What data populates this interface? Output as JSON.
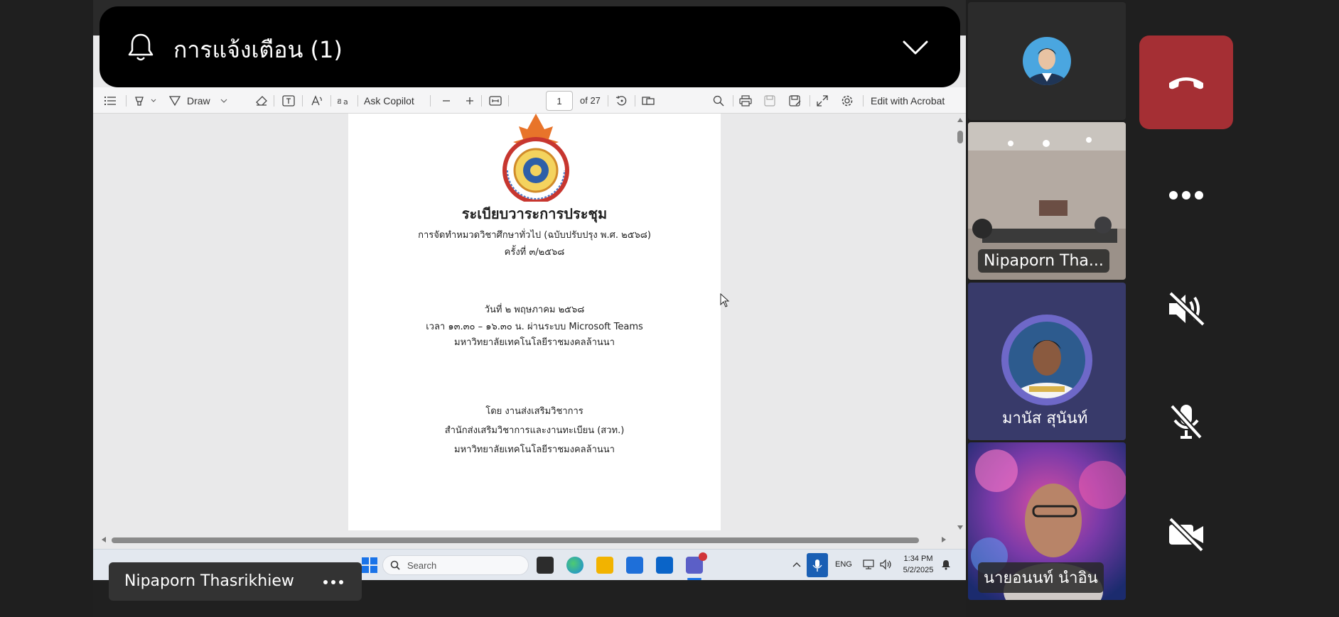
{
  "notification": {
    "text": "การแจ้งเตือน (1)",
    "bell_icon": "bell-icon",
    "chevron_icon": "chevron-down-icon"
  },
  "toolbar": {
    "draw_label": "Draw",
    "ask_copilot_label": "Ask Copilot",
    "page_current": "1",
    "page_total": "of 27",
    "edit_label": "Edit with Acrobat"
  },
  "document": {
    "title": "ระเบียบวาระการประชุม",
    "subtitle": "การจัดทำหมวดวิชาศึกษาทั่วไป (ฉบับปรับปรุง พ.ศ. ๒๕๖๘)",
    "session": "ครั้งที่ ๓/๒๕๖๘",
    "date": "วันที่ ๒ พฤษภาคม ๒๕๖๘",
    "time": "เวลา ๑๓.๓๐ – ๑๖.๓๐ น. ผ่านระบบ Microsoft Teams",
    "university_1": "มหาวิทยาลัยเทคโนโลยีราชมงคลล้านนา",
    "by": "โดย งานส่งเสริมวิชาการ",
    "office": "สำนักส่งเสริมวิชาการและงานทะเบียน (สวท.)",
    "university_2": "มหาวิทยาลัยเทคโนโลยีราชมงคลล้านนา"
  },
  "taskbar": {
    "search_placeholder": "Search",
    "lang": "ENG",
    "time": "1:34 PM",
    "date": "5/2/2025"
  },
  "speaker": {
    "name": "Nipaporn Thasrikhiew"
  },
  "participants": [
    {
      "name": ""
    },
    {
      "name": "Nipaporn Tha..."
    },
    {
      "name": "มานัส สุนันท์"
    },
    {
      "name": "นายอนนท์  นำอิน"
    }
  ],
  "colors": {
    "hangup": "#a52f34",
    "avatar_ring": "#6e68c8",
    "background": "#1f1f1f"
  }
}
